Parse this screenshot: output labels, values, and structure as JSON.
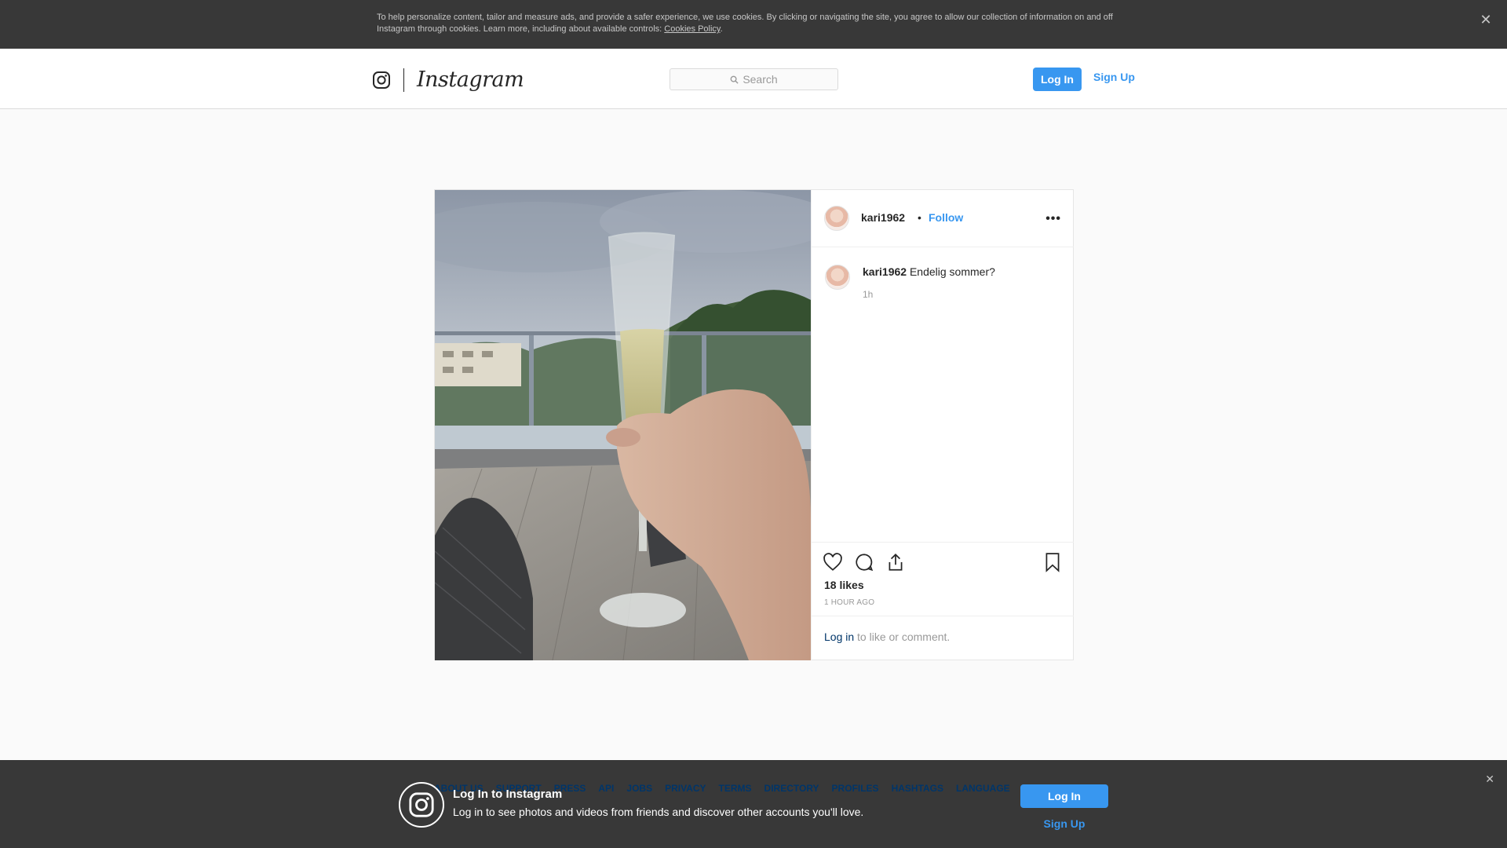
{
  "cookie_banner": {
    "text": "To help personalize content, tailor and measure ads, and provide a safer experience, we use cookies. By clicking or navigating the site, you agree to allow our collection of information on and off Instagram through cookies. Learn more, including about available controls:",
    "policy_link": "Cookies Policy",
    "trailing": ".",
    "close": "✕"
  },
  "nav": {
    "wordmark": "Instagram",
    "search_placeholder": "Search",
    "login": "Log In",
    "signup": "Sign Up"
  },
  "post": {
    "username": "kari1962",
    "separator": "•",
    "follow": "Follow",
    "more": "•••",
    "caption_user": "kari1962",
    "caption": "Endelig sommer?",
    "caption_time": "1h",
    "likes": "18 likes",
    "timestamp": "1 HOUR AGO",
    "login_link": "Log in",
    "login_rest": "to like or comment."
  },
  "footer_links": [
    "ABOUT US",
    "SUPPORT",
    "PRESS",
    "API",
    "JOBS",
    "PRIVACY",
    "TERMS",
    "DIRECTORY",
    "PROFILES",
    "HASHTAGS",
    "LANGUAGE"
  ],
  "bottom_bar": {
    "title": "Log In to Instagram",
    "description": "Log in to see photos and videos from friends and discover other accounts you'll love.",
    "login": "Log In",
    "signup": "Sign Up",
    "close": "✕"
  },
  "colors": {
    "accent": "#3897f0",
    "banner_bg": "#383838",
    "page_bg": "#fafafa"
  }
}
